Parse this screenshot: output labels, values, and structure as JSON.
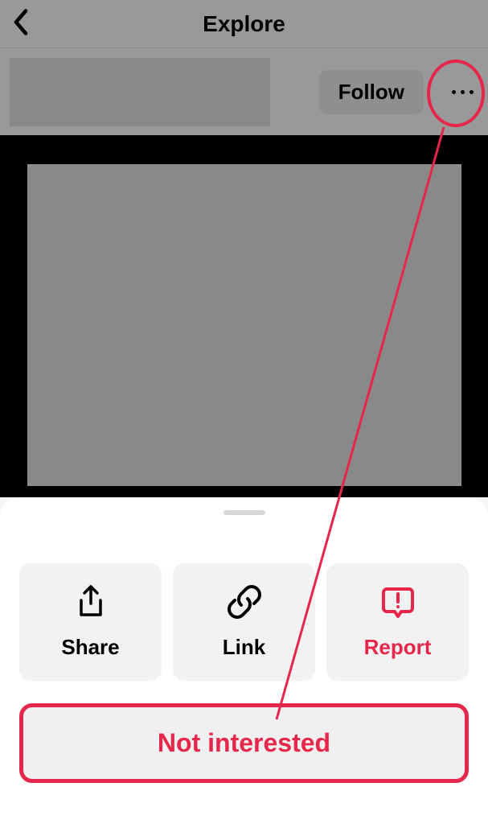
{
  "header": {
    "title": "Explore"
  },
  "profile": {
    "follow_label": "Follow"
  },
  "actions": {
    "share": "Share",
    "link": "Link",
    "report": "Report",
    "not_interested": "Not interested"
  }
}
